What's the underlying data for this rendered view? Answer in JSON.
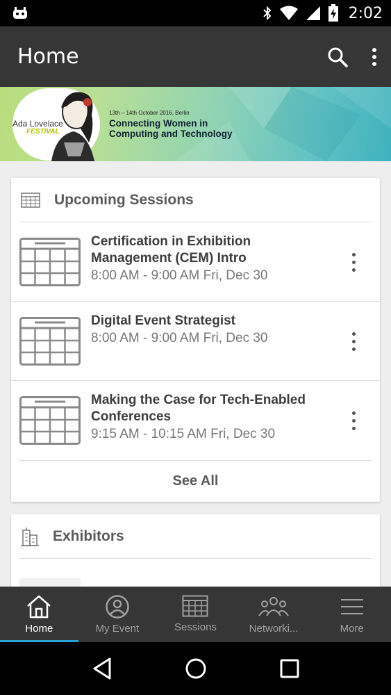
{
  "status_bar": {
    "time": "2:02"
  },
  "app_bar": {
    "title": "Home"
  },
  "banner": {
    "logo_name": "Ada Lovelace",
    "logo_sub": "FESTIVAL",
    "dates": "13th – 14th October 2016, Berlin",
    "title": "Connecting Women in Computing and Technology"
  },
  "upcoming": {
    "title": "Upcoming Sessions",
    "sessions": [
      {
        "title": "Certification in Exhibition Management (CEM) Intro",
        "time": "8:00 AM - 9:00 AM Fri, Dec 30"
      },
      {
        "title": "Digital Event Strategist",
        "time": "8:00 AM - 9:00 AM Fri, Dec 30"
      },
      {
        "title": "Making the Case for Tech-Enabled Conferences",
        "time": "9:15 AM - 10:15 AM Fri, Dec 30"
      }
    ],
    "see_all": "See All"
  },
  "exhibitors": {
    "title": "Exhibitors"
  },
  "bottom_nav": {
    "items": [
      {
        "label": "Home"
      },
      {
        "label": "My Event"
      },
      {
        "label": "Sessions"
      },
      {
        "label": "Networki..."
      },
      {
        "label": "More"
      }
    ]
  },
  "colors": {
    "app_bar": "#363636",
    "accent": "#29a3d9",
    "background": "#eeeeee"
  }
}
